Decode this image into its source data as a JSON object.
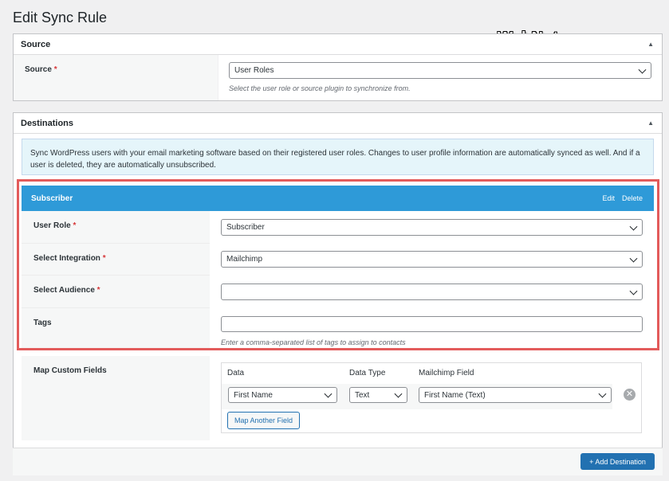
{
  "page_title": "Edit Sync Rule",
  "watermark": "WebNots.com",
  "source": {
    "header": "Source",
    "label": "Source",
    "required_mark": "*",
    "value": "User Roles",
    "help": "Select the user role or source plugin to synchronize from."
  },
  "destinations": {
    "header": "Destinations",
    "notice": "Sync WordPress users with your email marketing software based on their registered user roles. Changes to user profile information are automatically synced as well. And if a user is deleted, they are automatically unsubscribed.",
    "card": {
      "title": "Subscriber",
      "edit": "Edit",
      "delete": "Delete",
      "fields": {
        "user_role": {
          "label": "User Role",
          "value": "Subscriber"
        },
        "integration": {
          "label": "Select Integration",
          "value": "Mailchimp"
        },
        "audience": {
          "label": "Select Audience",
          "value": ""
        },
        "tags": {
          "label": "Tags",
          "value": "",
          "help": "Enter a comma-separated list of tags to assign to contacts"
        }
      },
      "required_mark": "*"
    },
    "map": {
      "label": "Map Custom Fields",
      "columns": [
        "Data",
        "Data Type",
        "Mailchimp Field"
      ],
      "row": {
        "data": "First Name",
        "type": "Text",
        "field": "First Name (Text)"
      },
      "map_another": "Map Another Field"
    },
    "add_destination": "+ Add Destination"
  },
  "colors": {
    "accent": "#2271b1",
    "card_header": "#2e9ad8",
    "highlight_border": "#e35b5b",
    "notice_bg": "#e5f5fa"
  },
  "icons": [
    "triangle-up-icon",
    "chevron-down-icon",
    "remove-circle-icon"
  ]
}
